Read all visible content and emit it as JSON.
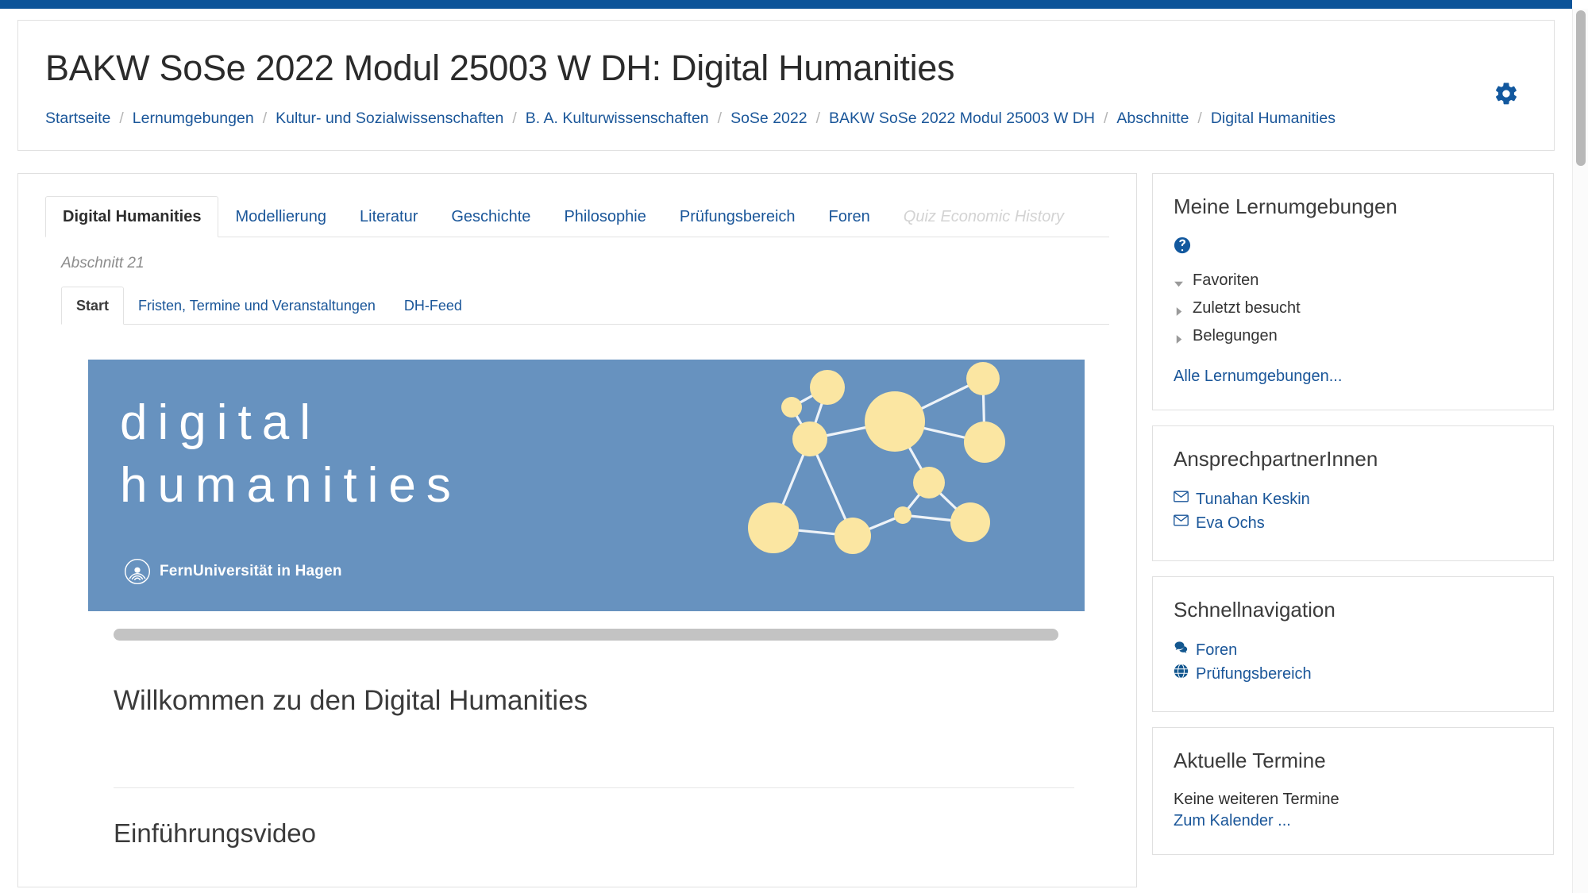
{
  "browser": {
    "top_accent_color": "#0c5499",
    "scrollbar": {
      "name": "vertical-scrollbar"
    }
  },
  "header": {
    "title": "BAKW SoSe 2022 Modul 25003 W DH: Digital Humanities",
    "settings_icon": "gear-icon",
    "breadcrumb": [
      "Startseite",
      "Lernumgebungen",
      "Kultur- und Sozialwissenschaften",
      "B. A. Kulturwissenschaften",
      "SoSe 2022",
      "BAKW SoSe 2022 Modul 25003 W DH",
      "Abschnitte",
      "Digital Humanities"
    ],
    "breadcrumb_separator": "/"
  },
  "main": {
    "primary_tabs": [
      {
        "label": "Digital Humanities",
        "state": "active"
      },
      {
        "label": "Modellierung",
        "state": "link"
      },
      {
        "label": "Literatur",
        "state": "link"
      },
      {
        "label": "Geschichte",
        "state": "link"
      },
      {
        "label": "Philosophie",
        "state": "link"
      },
      {
        "label": "Prüfungsbereich",
        "state": "link"
      },
      {
        "label": "Foren",
        "state": "link"
      },
      {
        "label": "Quiz Economic History",
        "state": "disabled"
      }
    ],
    "section_label": "Abschnitt 21",
    "secondary_tabs": [
      {
        "label": "Start",
        "state": "active"
      },
      {
        "label": "Fristen, Termine und Veranstaltungen",
        "state": "link"
      },
      {
        "label": "DH-Feed",
        "state": "link"
      }
    ],
    "banner": {
      "line1": "digital",
      "line2": "humanities",
      "logo_text": "FernUniversität in Hagen",
      "logo_icon": "fernuni-logo-icon",
      "graphic": "network-graph-icon",
      "background_color": "#6792bf",
      "node_color": "#fbe6a2",
      "text_color": "#ffffff"
    },
    "content": {
      "heading": "Willkommen zu den Digital Humanities",
      "subheading": "Einführungsvideo"
    }
  },
  "sidebar": {
    "panels": [
      {
        "title": "Meine Lernumgebungen",
        "help_icon": "help-circle-icon",
        "tree": [
          {
            "label": "Favoriten",
            "icon": "chevron-down-icon",
            "expanded": true
          },
          {
            "label": "Zuletzt besucht",
            "icon": "chevron-right-icon",
            "expanded": false
          },
          {
            "label": "Belegungen",
            "icon": "chevron-right-icon",
            "expanded": false
          }
        ],
        "footer_link": "Alle Lernumgebungen..."
      },
      {
        "title": "AnsprechpartnerInnen",
        "contacts": [
          {
            "label": "Tunahan Keskin",
            "icon": "envelope-icon"
          },
          {
            "label": "Eva Ochs",
            "icon": "envelope-icon"
          }
        ]
      },
      {
        "title": "Schnellnavigation",
        "links": [
          {
            "label": "Foren",
            "icon": "chat-bubble-icon"
          },
          {
            "label": "Prüfungsbereich",
            "icon": "globe-icon"
          }
        ]
      },
      {
        "title": "Aktuelle Termine",
        "empty_text": "Keine weiteren Termine",
        "link": "Zum Kalender ..."
      }
    ]
  },
  "colors": {
    "link_blue": "#1a5699",
    "accent_blue": "#0c5499",
    "banner_blue": "#6792bf",
    "node_yellow": "#fbe6a2",
    "border_grey": "#e0e0e0"
  }
}
